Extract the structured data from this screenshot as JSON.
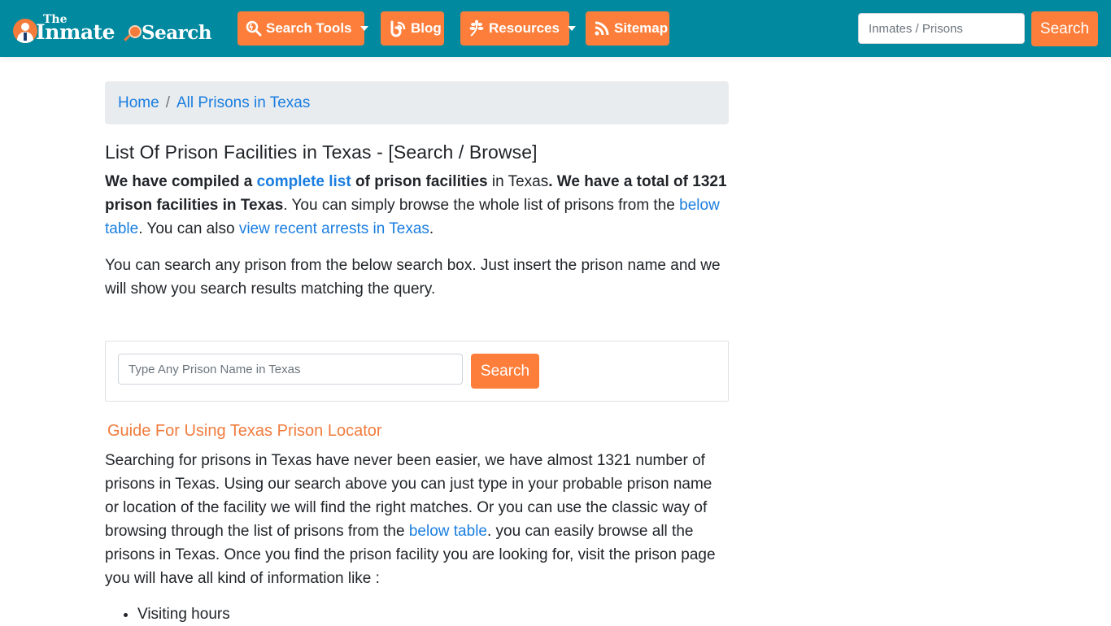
{
  "brand": {
    "logo_the": "The",
    "logo_inmate": "Inmate",
    "logo_search": "Search",
    "accent_color": "#fd7e3a",
    "navbar_color": "#00899f",
    "link_color": "#1a7ee0"
  },
  "nav": {
    "items": [
      {
        "label": "Search Tools",
        "icon": "search-tools-icon",
        "dropdown": true
      },
      {
        "label": "Blog",
        "icon": "blog-icon",
        "dropdown": false
      },
      {
        "label": "Resources",
        "icon": "leaf-icon",
        "dropdown": true
      },
      {
        "label": "Sitemap",
        "icon": "rss-icon",
        "dropdown": false
      }
    ],
    "search_placeholder": "Inmates / Prisons",
    "search_value": "",
    "search_button": "Search"
  },
  "breadcrumb": {
    "items": [
      "Home",
      "All Prisons in Texas"
    ],
    "separator": "/"
  },
  "page": {
    "title": "List Of Prison Facilities in Texas - [Search / Browse]",
    "intro": {
      "p1": "We have compiled a ",
      "link_complete_list": "complete list",
      "p2": " of prison facilities",
      "p3": " in Texas",
      "p4": ". We have a total of 1321 prison facilities in Texas",
      "p5": ". You can simply browse the whole list of prisons from the ",
      "link_below_table": "below table",
      "p6": ". You can also ",
      "link_recent_arrests": "view recent arrests in Texas",
      "p7": "."
    },
    "search_hint": "You can search any prison from the below search box. Just insert the prison name and we will show you search results matching the query.",
    "prison_search": {
      "placeholder": "Type Any Prison Name in Texas",
      "value": "",
      "button": "Search"
    },
    "guide": {
      "title": "Guide For Using Texas Prison Locator",
      "p1": "Searching for prisons in Texas have never been easier, we have almost 1321 number of prisons in Texas. Using our search above you can just type in your probable prison name or location of the facility we will find the right matches. Or you can use the classic way of browsing through the list of prisons from the ",
      "link_below_table": "below table",
      "p2": ". you can easily browse all the prisons in Texas. Once you find the prison facility you are looking for, visit the prison page you will have all kind of information like :",
      "list": [
        "Visiting hours"
      ]
    }
  }
}
